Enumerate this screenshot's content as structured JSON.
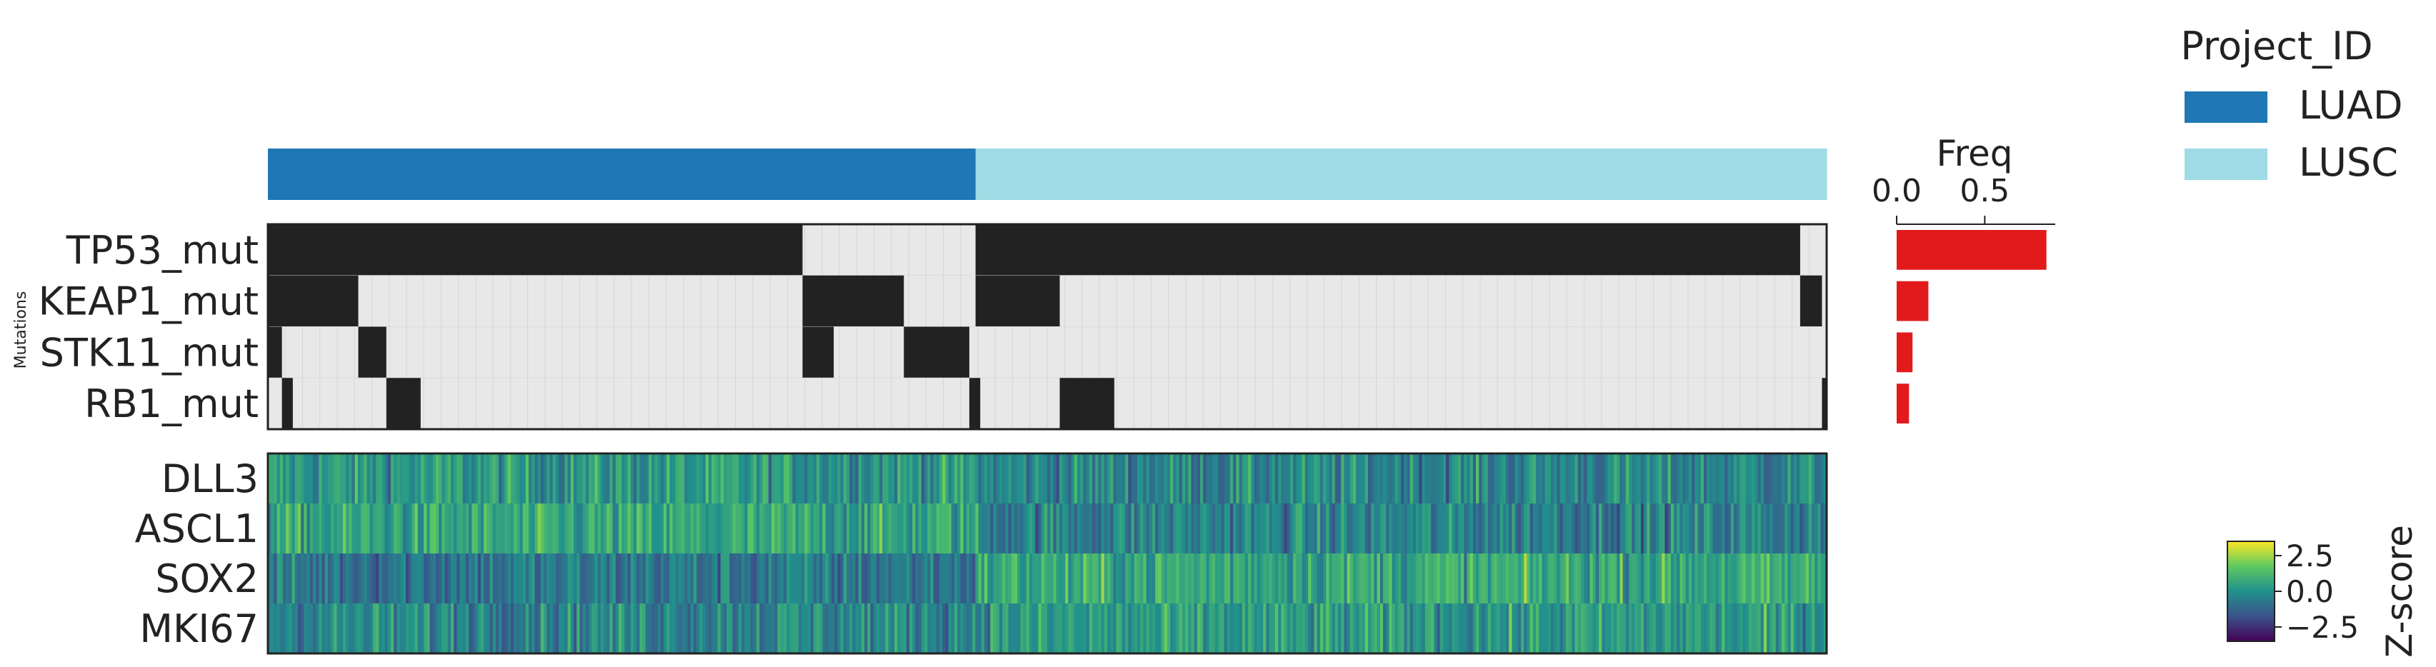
{
  "chart_data": [
    {
      "type": "heatmap",
      "panel": "annotation",
      "labels": {
        "legend_title": "Project_ID"
      },
      "groups": [
        {
          "name": "LUAD",
          "color": "#1f77b4",
          "fraction": 0.454
        },
        {
          "name": "LUSC",
          "color": "#9fdbe5",
          "fraction": 0.546
        }
      ]
    },
    {
      "type": "heatmap",
      "panel": "mutations",
      "labels": {
        "ylabel": "Mutations"
      },
      "rows": [
        "TP53_mut",
        "KEAP1_mut",
        "STK11_mut",
        "RB1_mut"
      ],
      "colors": {
        "mutated": "#222222",
        "wildtype": "#e8e8e8"
      },
      "mutated_segments": {
        "TP53_mut": [
          [
            0.0,
            0.343
          ],
          [
            0.454,
            0.983
          ]
        ],
        "KEAP1_mut": [
          [
            0.0,
            0.058
          ],
          [
            0.343,
            0.408
          ],
          [
            0.454,
            0.508
          ],
          [
            0.983,
            0.997
          ]
        ],
        "STK11_mut": [
          [
            0.0,
            0.009
          ],
          [
            0.058,
            0.076
          ],
          [
            0.343,
            0.363
          ],
          [
            0.408,
            0.45
          ]
        ],
        "RB1_mut": [
          [
            0.009,
            0.016
          ],
          [
            0.076,
            0.098
          ],
          [
            0.45,
            0.457
          ],
          [
            0.508,
            0.543
          ],
          [
            0.997,
            1.0
          ]
        ]
      }
    },
    {
      "type": "bar",
      "panel": "frequency",
      "orientation": "horizontal",
      "labels": {
        "xlabel": "Freq",
        "xticks": [
          "0.0",
          "0.5"
        ]
      },
      "categories": [
        "TP53_mut",
        "KEAP1_mut",
        "STK11_mut",
        "RB1_mut"
      ],
      "values": [
        0.85,
        0.18,
        0.09,
        0.07
      ],
      "xlim": [
        0,
        0.9
      ],
      "color": "#e31a1c"
    },
    {
      "type": "heatmap",
      "panel": "expression",
      "rows": [
        "DLL3",
        "ASCL1",
        "SOX2",
        "MKI67"
      ],
      "colormap": "viridis",
      "n_columns": 520,
      "vmin": -3.5,
      "vmax": 3.5,
      "colorbar": {
        "label": "Z-score",
        "ticks": [
          "2.5",
          "0.0",
          "−2.5"
        ]
      }
    }
  ]
}
